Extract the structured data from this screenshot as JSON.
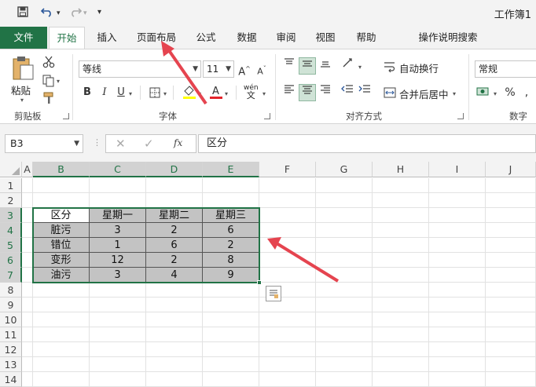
{
  "quick_access": {
    "save_icon": "save-icon",
    "undo_icon": "undo-icon",
    "redo_icon": "redo-icon",
    "customize": "▾"
  },
  "window": {
    "title": "工作簿1"
  },
  "tabs": [
    {
      "label": "文件"
    },
    {
      "label": "开始"
    },
    {
      "label": "插入"
    },
    {
      "label": "页面布局"
    },
    {
      "label": "公式"
    },
    {
      "label": "数据"
    },
    {
      "label": "审阅"
    },
    {
      "label": "视图"
    },
    {
      "label": "帮助"
    },
    {
      "label": "操作说明搜索"
    }
  ],
  "ribbon": {
    "clipboard": {
      "paste_label": "粘贴",
      "group_label": "剪贴板"
    },
    "font": {
      "font_name": "等线",
      "font_size": "11",
      "group_label": "字体",
      "bold": "B",
      "italic": "I",
      "underline": "U",
      "phonetic": "wén"
    },
    "alignment": {
      "wrap_text": "自动换行",
      "merge_center": "合并后居中",
      "group_label": "对齐方式"
    },
    "number": {
      "format": "常规",
      "percent": "%",
      "group_label": "数字"
    }
  },
  "formula_bar": {
    "name_box": "B3",
    "fx": "fx",
    "value": "区分"
  },
  "columns": [
    "A",
    "B",
    "C",
    "D",
    "E",
    "F",
    "G",
    "H",
    "I",
    "J"
  ],
  "rows": [
    "1",
    "2",
    "3",
    "4",
    "5",
    "6",
    "7",
    "8",
    "9",
    "10",
    "11",
    "12",
    "13",
    "14"
  ],
  "table": {
    "header": [
      "区分",
      "星期一",
      "星期二",
      "星期三"
    ],
    "rows": [
      [
        "脏污",
        "3",
        "2",
        "6"
      ],
      [
        "错位",
        "1",
        "6",
        "2"
      ],
      [
        "变形",
        "12",
        "2",
        "8"
      ],
      [
        "油污",
        "3",
        "4",
        "9"
      ]
    ]
  },
  "colors": {
    "accent": "#217346",
    "arrow": "#e5444f",
    "selection_fill": "#c3c3c3"
  }
}
